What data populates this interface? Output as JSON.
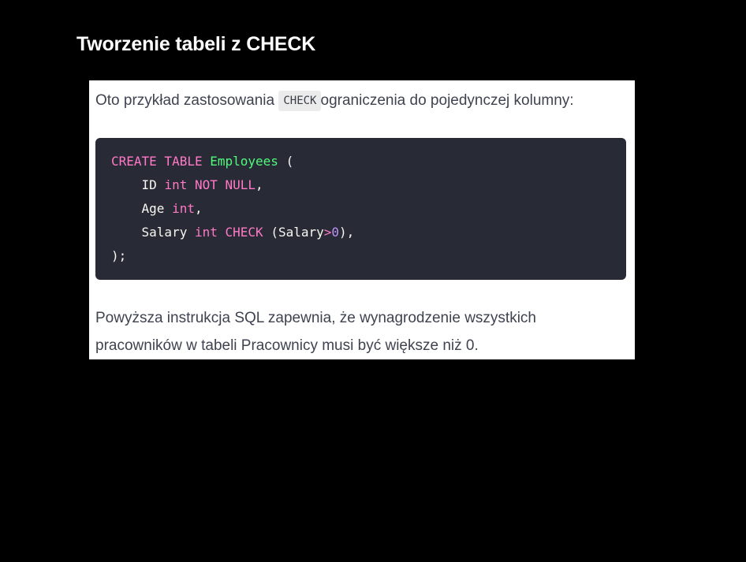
{
  "slide": {
    "title": "Tworzenie tabeli z CHECK"
  },
  "content": {
    "intro_before": "Oto przykład zastosowania ",
    "intro_code": "CHECK",
    "intro_after": "ograniczenia do pojedynczej kolumny:",
    "outro": "Powyższa instrukcja SQL zapewnia, że wynagrodzenie wszystkich pracowników w tabeli Pracownicy musi być większe niż 0."
  },
  "code": {
    "language": "sql",
    "lines": [
      [
        {
          "t": "CREATE TABLE",
          "k": "kw"
        },
        {
          "t": " ",
          "k": "plain"
        },
        {
          "t": "Employees",
          "k": "name"
        },
        {
          "t": " (",
          "k": "plain"
        }
      ],
      [
        {
          "t": "    ID ",
          "k": "plain"
        },
        {
          "t": "int",
          "k": "kw"
        },
        {
          "t": " ",
          "k": "plain"
        },
        {
          "t": "NOT NULL",
          "k": "kw"
        },
        {
          "t": ",",
          "k": "plain"
        }
      ],
      [
        {
          "t": "    Age ",
          "k": "plain"
        },
        {
          "t": "int",
          "k": "kw"
        },
        {
          "t": ",",
          "k": "plain"
        }
      ],
      [
        {
          "t": "    Salary ",
          "k": "plain"
        },
        {
          "t": "int",
          "k": "kw"
        },
        {
          "t": " ",
          "k": "plain"
        },
        {
          "t": "CHECK",
          "k": "kw"
        },
        {
          "t": " (Salary",
          "k": "plain"
        },
        {
          "t": ">",
          "k": "op"
        },
        {
          "t": "0",
          "k": "num"
        },
        {
          "t": "),",
          "k": "plain"
        }
      ],
      [
        {
          "t": ");",
          "k": "plain"
        }
      ]
    ],
    "colors": {
      "background": "#282a36",
      "keyword": "#ff79c6",
      "identifier": "#50fa7b",
      "number": "#bd93f9",
      "text": "#f8f8f2"
    }
  }
}
